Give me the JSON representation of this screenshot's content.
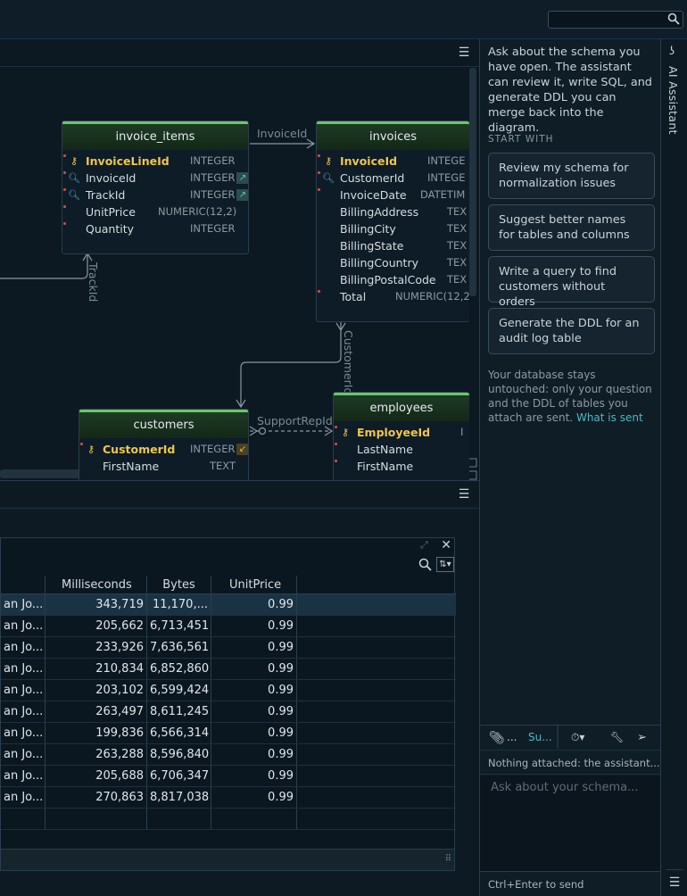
{
  "top_search": {
    "placeholder": ""
  },
  "diagram": {
    "tables": {
      "invoice_items": {
        "name": "invoice_items",
        "columns": [
          {
            "name": "InvoiceLineId",
            "type": "INTEGER"
          },
          {
            "name": "InvoiceId",
            "type": "INTEGER"
          },
          {
            "name": "TrackId",
            "type": "INTEGER"
          },
          {
            "name": "UnitPrice",
            "type": "NUMERIC(12,2)"
          },
          {
            "name": "Quantity",
            "type": "INTEGER"
          }
        ]
      },
      "invoices": {
        "name": "invoices",
        "columns": [
          {
            "name": "InvoiceId",
            "type": "INTEGE"
          },
          {
            "name": "CustomerId",
            "type": "INTEGE"
          },
          {
            "name": "InvoiceDate",
            "type": "DATETIM"
          },
          {
            "name": "BillingAddress",
            "type": "TEX"
          },
          {
            "name": "BillingCity",
            "type": "TEX"
          },
          {
            "name": "BillingState",
            "type": "TEX"
          },
          {
            "name": "BillingCountry",
            "type": "TEX"
          },
          {
            "name": "BillingPostalCode",
            "type": "TEX"
          },
          {
            "name": "Total",
            "type": "NUMERIC(12,2"
          }
        ]
      },
      "customers": {
        "name": "customers",
        "columns": [
          {
            "name": "CustomerId",
            "type": "INTEGER"
          },
          {
            "name": "FirstName",
            "type": "TEXT"
          }
        ]
      },
      "employees": {
        "name": "employees",
        "columns": [
          {
            "name": "EmployeeId",
            "type": "I"
          },
          {
            "name": "LastName",
            "type": ""
          },
          {
            "name": "FirstName",
            "type": ""
          }
        ]
      }
    },
    "edges": {
      "invoice_id": "InvoiceId",
      "track_id": "TrackId",
      "customer_id": "CustomerId",
      "support_rep_id": "SupportRepId"
    }
  },
  "results": {
    "columns": [
      "Milliseconds",
      "Bytes",
      "UnitPrice"
    ],
    "rows": [
      {
        "name": "an Jo...",
        "ms": "343,719",
        "bytes": "11,170,...",
        "price": "0.99"
      },
      {
        "name": "an Jo...",
        "ms": "205,662",
        "bytes": "6,713,451",
        "price": "0.99"
      },
      {
        "name": "an Jo...",
        "ms": "233,926",
        "bytes": "7,636,561",
        "price": "0.99"
      },
      {
        "name": "an Jo...",
        "ms": "210,834",
        "bytes": "6,852,860",
        "price": "0.99"
      },
      {
        "name": "an Jo...",
        "ms": "203,102",
        "bytes": "6,599,424",
        "price": "0.99"
      },
      {
        "name": "an Jo...",
        "ms": "263,497",
        "bytes": "8,611,245",
        "price": "0.99"
      },
      {
        "name": "an Jo...",
        "ms": "199,836",
        "bytes": "6,566,314",
        "price": "0.99"
      },
      {
        "name": "an Jo...",
        "ms": "263,288",
        "bytes": "8,596,840",
        "price": "0.99"
      },
      {
        "name": "an Jo...",
        "ms": "205,688",
        "bytes": "6,706,347",
        "price": "0.99"
      },
      {
        "name": "an Jo...",
        "ms": "270,863",
        "bytes": "8,817,038",
        "price": "0.99"
      }
    ]
  },
  "assistant": {
    "tab_label": "AI Assistant",
    "intro": "Ask about the schema you have open. The assistant can review it, write SQL, and generate DDL you can merge back into the diagram.",
    "start_with": "START WITH",
    "suggestions": [
      "Review my schema for normalization issues",
      "Suggest better names for tables and columns",
      "Write a query to find customers without orders",
      "Generate the DDL for an audit log table"
    ],
    "note": "Your database stays untouched: only your question and the DDL of tables you attach are sent.",
    "note_link": "What is sent",
    "toolbar": {
      "attach_more": "...",
      "mode": "Su..."
    },
    "attached": "Nothing attached: the assistant...",
    "prompt_placeholder": "Ask about your schema...",
    "send_hint": "Ctrl+Enter to send"
  },
  "colors": {
    "accent": "#4fb8c0",
    "table_header": "#6bc76b",
    "pk_key": "#f0c64a"
  }
}
